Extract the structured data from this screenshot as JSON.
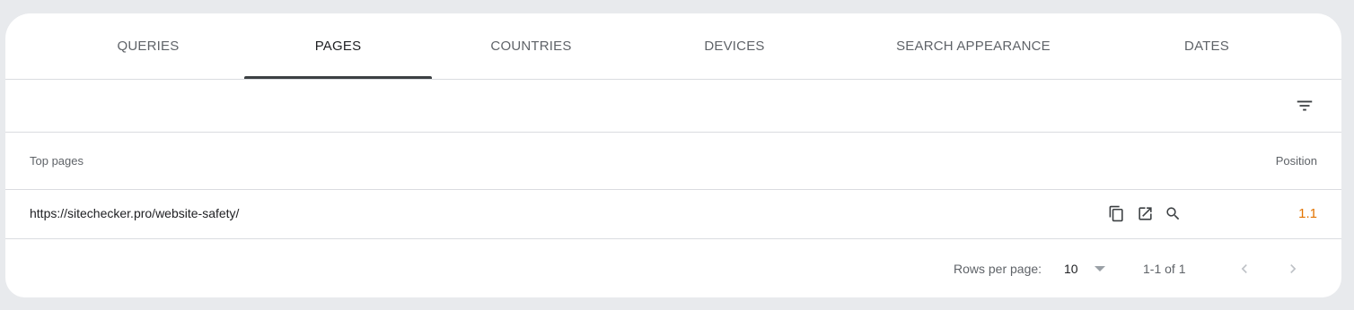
{
  "tabs": [
    {
      "label": "QUERIES",
      "active": false
    },
    {
      "label": "PAGES",
      "active": true
    },
    {
      "label": "COUNTRIES",
      "active": false
    },
    {
      "label": "DEVICES",
      "active": false
    },
    {
      "label": "SEARCH APPEARANCE",
      "active": false
    },
    {
      "label": "DATES",
      "active": false
    }
  ],
  "filter": {
    "icon": "filter-icon"
  },
  "table": {
    "columns": {
      "left": "Top pages",
      "right": "Position"
    },
    "rows": [
      {
        "url": "https://sitechecker.pro/website-safety/",
        "position": "1.1",
        "icons": [
          "copy-icon",
          "open-in-new-icon",
          "search-icon"
        ]
      }
    ]
  },
  "pagination": {
    "rows_per_page_label": "Rows per page:",
    "rows_per_page_value": "10",
    "range": "1-1 of 1"
  },
  "colors": {
    "position_value": "#e37400",
    "active_tab_indicator": "#3c4043"
  }
}
